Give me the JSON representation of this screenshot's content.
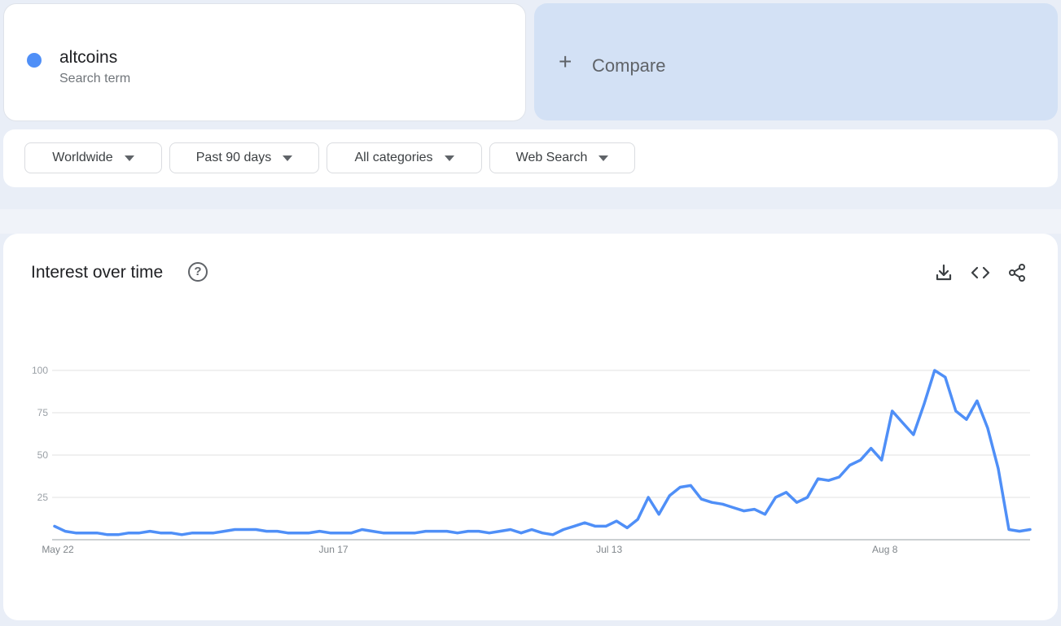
{
  "search_term": {
    "name": "altcoins",
    "subtitle": "Search term",
    "color": "#4f8ff7"
  },
  "compare": {
    "plus": "+",
    "label": "Compare"
  },
  "filters": [
    {
      "label": "Worldwide"
    },
    {
      "label": "Past 90 days"
    },
    {
      "label": "All categories"
    },
    {
      "label": "Web Search"
    }
  ],
  "chart_card": {
    "title": "Interest over time",
    "help": "?",
    "icons": [
      "download-icon",
      "embed-code-icon",
      "share-icon"
    ]
  },
  "chart_data": {
    "type": "line",
    "title": "",
    "xlabel": "",
    "ylabel": "",
    "ylim": [
      0,
      100
    ],
    "yticks": [
      25,
      50,
      75,
      100
    ],
    "grid": true,
    "x_tick_labels": [
      {
        "label": "May 22",
        "index": 0
      },
      {
        "label": "Jun 17",
        "index": 26
      },
      {
        "label": "Jul 13",
        "index": 52
      },
      {
        "label": "Aug 8",
        "index": 78
      }
    ],
    "series": [
      {
        "color": "#4f8ff7",
        "values": [
          8,
          5,
          4,
          4,
          4,
          3,
          3,
          4,
          4,
          5,
          4,
          4,
          3,
          4,
          4,
          4,
          5,
          6,
          6,
          6,
          5,
          5,
          4,
          4,
          4,
          5,
          4,
          4,
          4,
          6,
          5,
          4,
          4,
          4,
          4,
          5,
          5,
          5,
          4,
          5,
          5,
          4,
          5,
          6,
          4,
          6,
          4,
          3,
          6,
          8,
          10,
          8,
          8,
          11,
          7,
          12,
          25,
          15,
          26,
          31,
          32,
          24,
          22,
          21,
          19,
          17,
          18,
          15,
          25,
          28,
          22,
          25,
          36,
          35,
          37,
          44,
          47,
          54,
          47,
          76,
          69,
          62,
          80,
          100,
          96,
          76,
          71,
          82,
          66,
          42,
          6,
          5,
          6
        ]
      }
    ]
  }
}
